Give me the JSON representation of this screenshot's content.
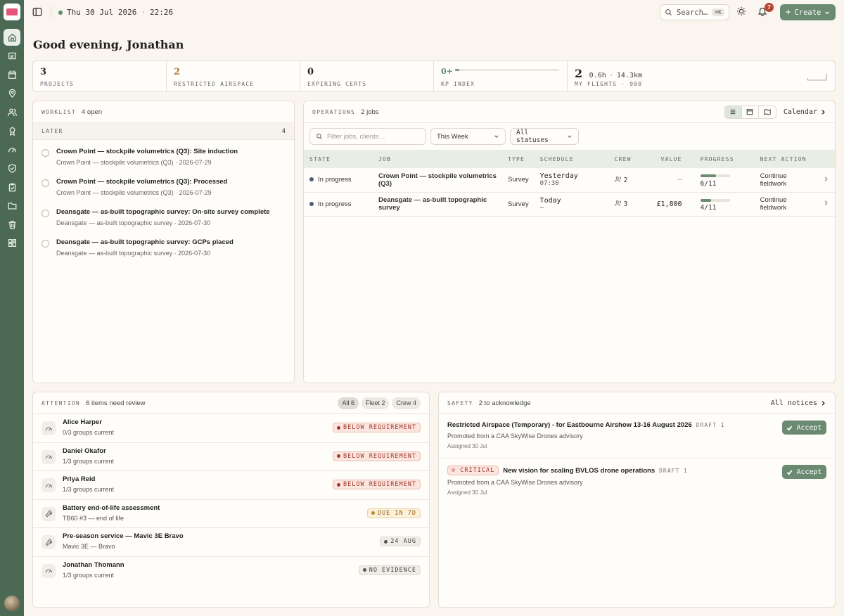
{
  "topbar": {
    "date": "Thu 30 Jul 2026",
    "sep": "·",
    "time": "22:26",
    "search_label": "Search…",
    "search_kbd": "⌘K",
    "notifications_count": "7",
    "create_label": "Create"
  },
  "greeting": "Good evening, Jonathan",
  "stats": {
    "projects": {
      "value": "3",
      "label": "PROJECTS"
    },
    "airspace": {
      "value": "2",
      "label": "RESTRICTED AIRSPACE"
    },
    "certs": {
      "value": "0",
      "label": "EXPIRING CERTS"
    },
    "kp": {
      "value": "0+",
      "label": "KP INDEX",
      "level": 0.04
    },
    "flights": {
      "value": "2",
      "hours": "0.6h",
      "sep": "·",
      "distance": "14.3km",
      "label": "MY FLIGHTS · 900"
    }
  },
  "worklist": {
    "title": "WORKLIST",
    "count": "4 open",
    "section_label": "LATER",
    "section_count": "4",
    "items": [
      {
        "title": "Crown Point — stockpile volumetrics (Q3): Site induction",
        "sub": "Crown Point — stockpile volumetrics (Q3) · 2026-07-29"
      },
      {
        "title": "Crown Point — stockpile volumetrics (Q3): Processed",
        "sub": "Crown Point — stockpile volumetrics (Q3) · 2026-07-29"
      },
      {
        "title": "Deansgate — as-built topographic survey: On-site survey complete",
        "sub": "Deansgate — as-built topographic survey · 2026-07-30"
      },
      {
        "title": "Deansgate — as-built topographic survey: GCPs placed",
        "sub": "Deansgate — as-built topographic survey · 2026-07-30"
      }
    ]
  },
  "operations": {
    "title": "OPERATIONS",
    "count": "2 jobs",
    "calendar_label": "Calendar",
    "filter_placeholder": "Filter jobs, clients…",
    "period": "This Week",
    "status": "All statuses",
    "columns": [
      "STATE",
      "JOB",
      "TYPE",
      "SCHEDULE",
      "CREW",
      "VALUE",
      "PROGRESS",
      "NEXT ACTION"
    ],
    "rows": [
      {
        "state": "In progress",
        "job": "Crown Point — stockpile volumetrics (Q3)",
        "type": "Survey",
        "schedule": "Yesterday",
        "schedule_sub": "07:30",
        "crew": "2",
        "value": "—",
        "progress": "6/11",
        "progress_frac": 0.545,
        "action": "Continue fieldwork"
      },
      {
        "state": "In progress",
        "job": "Deansgate — as-built topographic survey",
        "type": "Survey",
        "schedule": "Today",
        "schedule_sub": "—",
        "crew": "3",
        "value": "£1,800",
        "progress": "4/11",
        "progress_frac": 0.364,
        "action": "Continue fieldwork"
      }
    ]
  },
  "attention": {
    "title": "ATTENTION",
    "count": "6 items need review",
    "chips": [
      "All 6",
      "Fleet 2",
      "Crew 4"
    ],
    "items": [
      {
        "title": "Alice Harper",
        "sub": "0/3 groups current",
        "badge": "BELOW REQUIREMENT",
        "icon": "gauge-icon"
      },
      {
        "title": "Daniel Okafor",
        "sub": "1/3 groups current",
        "badge": "BELOW REQUIREMENT",
        "icon": "gauge-icon"
      },
      {
        "title": "Priya Reid",
        "sub": "1/3 groups current",
        "badge": "BELOW REQUIREMENT",
        "icon": "gauge-icon"
      },
      {
        "title": "Battery end-of-life assessment",
        "sub": "TB60 #3 — end of life",
        "badge": "DUE IN 7D",
        "icon": "wrench-icon"
      },
      {
        "title": "Pre-season service — Mavic 3E Bravo",
        "sub": "Mavic 3E — Bravo",
        "badge": "24 AUG",
        "icon": "wrench-icon"
      },
      {
        "title": "Jonathan Thomann",
        "sub": "1/3 groups current",
        "badge": "NO EVIDENCE",
        "icon": "gauge-icon"
      }
    ]
  },
  "safety": {
    "title": "SAFETY",
    "count": "2 to acknowledge",
    "all_label": "All notices",
    "accept_label": "Accept",
    "notices": [
      {
        "title": "Restricted Airspace (Temporary) - for Eastbourne Airshow 13-16 August 2026",
        "draft": "DRAFT 1",
        "sub": "Promoted from a CAA SkyWise Drones advisory",
        "date": "Assigned 30 Jul"
      },
      {
        "critical": "CRITICAL",
        "title": "New vision for scaling BVLOS drone operations",
        "draft": "DRAFT 1",
        "sub": "Promoted from a CAA SkyWise Drones advisory",
        "date": "Assigned 30 Jul"
      }
    ]
  },
  "colors": {
    "sidebar": "#4c6a53",
    "accent": "#6a8a72",
    "danger": "#a3392a",
    "warning": "#b8862e",
    "background": "#fbf5ef"
  }
}
